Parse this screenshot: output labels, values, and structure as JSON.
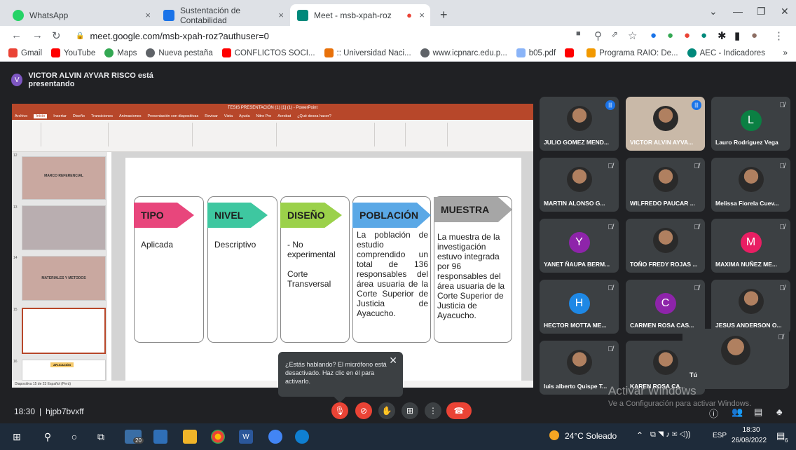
{
  "browser": {
    "tabs": [
      {
        "label": "WhatsApp",
        "close": "×",
        "favicon_color": "#25d366"
      },
      {
        "label": "Sustentación de Contabilidad",
        "close": "×",
        "favicon_color": "#1a73e8"
      },
      {
        "label": "Meet - msb-xpah-roz",
        "close": "×",
        "favicon_color": "#00897b",
        "recording": "●"
      }
    ],
    "new_tab": "+",
    "url": "meet.google.com/msb-xpah-roz?authuser=0",
    "bookmarks": [
      {
        "label": "Gmail",
        "color": "#ea4335"
      },
      {
        "label": "YouTube",
        "color": "#ff0000"
      },
      {
        "label": "Maps",
        "color": "#34a853"
      },
      {
        "label": "Nueva pestaña",
        "color": "#5f6368"
      },
      {
        "label": "CONFLICTOS SOCI...",
        "color": "#ff0000"
      },
      {
        "label": ":: Universidad Naci...",
        "color": "#e8710a"
      },
      {
        "label": "www.icpnarc.edu.p...",
        "color": "#5f6368"
      },
      {
        "label": "b05.pdf",
        "color": "#8ab4f8"
      },
      {
        "label": "",
        "color": "#ff0000"
      },
      {
        "label": "Programa RAIO: De...",
        "color": "#f29900"
      },
      {
        "label": "AEC - Indicadores",
        "color": "#00897b"
      }
    ],
    "bookmarks_more": "»"
  },
  "meet": {
    "presenter_initial": "V",
    "presenter_text": "VICTOR ALVIN AYVAR RISCO está presentando",
    "clock": "18:30",
    "separator": "|",
    "meeting_code": "hjpb7bvxff",
    "self_label": "Tú",
    "activate_title": "Activar Windows",
    "activate_sub": "Ve a Configuración para activar Windows.",
    "toast": "¿Estás hablando? El micrófono está desactivado. Haz clic en él para activarlo.",
    "participants": [
      {
        "name": "JULIO GOMEZ MEND...",
        "type": "photo",
        "speaking": true
      },
      {
        "name": "VICTOR ALVIN AYVA...",
        "type": "photo",
        "speaking": true,
        "highlight": true
      },
      {
        "name": "Lauro Rodriguez Vega",
        "type": "initial",
        "initial": "L",
        "color": "#0b8043"
      },
      {
        "name": "MARTIN ALONSO G...",
        "type": "photo"
      },
      {
        "name": "WILFREDO PAUCAR ...",
        "type": "photo"
      },
      {
        "name": "Melissa Fiorela Cuev...",
        "type": "photo"
      },
      {
        "name": "YANET ÑAUPA BERM...",
        "type": "initial",
        "initial": "Y",
        "color": "#8e24aa"
      },
      {
        "name": "TOÑO FREDY ROJAS ...",
        "type": "photo"
      },
      {
        "name": "MAXIMA NUÑEZ ME...",
        "type": "initial",
        "initial": "M",
        "color": "#e91e63"
      },
      {
        "name": "HECTOR MOTTA ME...",
        "type": "initial",
        "initial": "H",
        "color": "#1e88e5"
      },
      {
        "name": "CARMEN ROSA CAS...",
        "type": "initial",
        "initial": "C",
        "color": "#8e24aa"
      },
      {
        "name": "JESUS ANDERSON O...",
        "type": "photo"
      },
      {
        "name": "luis alberto Quispe T...",
        "type": "photo"
      },
      {
        "name": "KAREN ROSA CA...",
        "type": "photo"
      }
    ]
  },
  "ppt": {
    "title": "TESIS PRESENTACIÓN (1) [1] (1) - PowerPoint",
    "menu": [
      "Archivo",
      "Inicio",
      "Insertar",
      "Diseño",
      "Transiciones",
      "Animaciones",
      "Presentación con diapositivas",
      "Revisar",
      "Vista",
      "Ayuda",
      "Nitro Pro",
      "Acrobat",
      "¿Qué desea hacer?"
    ],
    "slide_nums": [
      "12",
      "13",
      "14",
      "15",
      "16"
    ],
    "thumb_labels": [
      "MARCO REFERENCIAL",
      "MATERIALES Y METODOS",
      "APLICACIÓN"
    ],
    "status": "Diapositiva 15 de 23   Español (Perú)"
  },
  "slide": {
    "cards": [
      {
        "head": "TIPO",
        "color": "#e8467c",
        "body": "Aplicada"
      },
      {
        "head": "NIVEL",
        "color": "#3ec7a0",
        "body": "Descriptivo"
      },
      {
        "head": "DISEÑO",
        "color": "#9bd14a",
        "body": "- No experimental\n\nCorte Transversal"
      },
      {
        "head": "POBLACIÓN",
        "color": "#5aa8e6",
        "body": "La población de estudio comprendido un total de 136 responsables del área usuaria de la Corte Superior de Justicia de Ayacucho."
      },
      {
        "head": "MUESTRA",
        "color": "#a6a6a6",
        "body": "La muestra de la investigación estuvo integrada por 96 responsables del área usuaria de la Corte Superior de Justicia de Ayacucho."
      }
    ]
  },
  "taskbar": {
    "weather": "24°C  Soleado",
    "lang": "ESP",
    "time": "18:30",
    "date": "26/08/2022",
    "badge": "20",
    "notif": "6"
  }
}
